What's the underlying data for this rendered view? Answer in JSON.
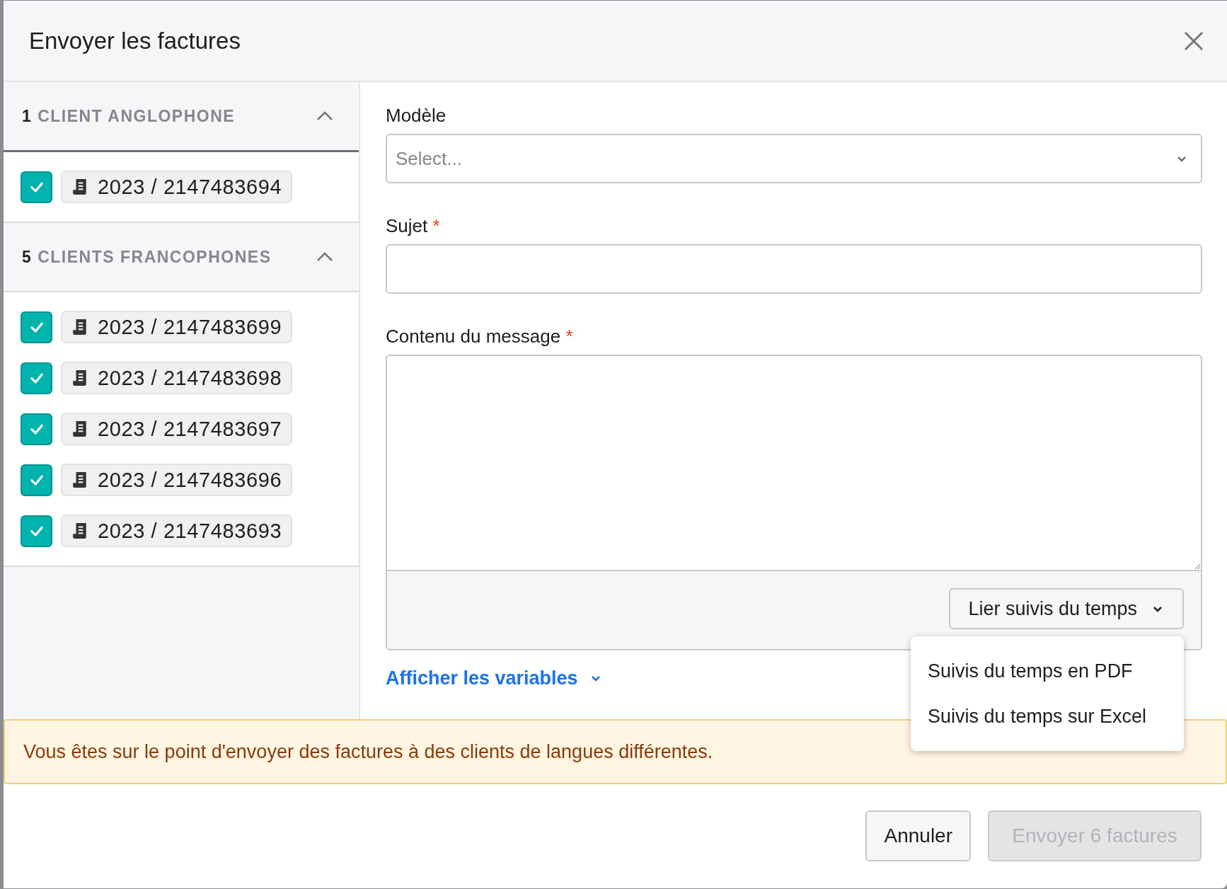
{
  "dialog": {
    "title": "Envoyer les factures"
  },
  "groups": [
    {
      "count": "1",
      "label": "CLIENT ANGLOPHONE",
      "expanded": true,
      "invoices": [
        {
          "number": "2023 / 2147483694",
          "checked": true
        }
      ]
    },
    {
      "count": "5",
      "label": "CLIENTS FRANCOPHONES",
      "expanded": true,
      "invoices": [
        {
          "number": "2023 / 2147483699",
          "checked": true
        },
        {
          "number": "2023 / 2147483698",
          "checked": true
        },
        {
          "number": "2023 / 2147483697",
          "checked": true
        },
        {
          "number": "2023 / 2147483696",
          "checked": true
        },
        {
          "number": "2023 / 2147483693",
          "checked": true
        }
      ]
    }
  ],
  "form": {
    "fields": [
      {
        "kind": "select",
        "label": "Modèle",
        "placeholder": "Select..."
      },
      {
        "kind": "input",
        "label": "Sujet",
        "required_mark": "*"
      },
      {
        "kind": "textarea",
        "label": "Contenu du message",
        "required_mark": "*"
      }
    ],
    "attach_button": {
      "label": "Lier suivis du temps",
      "menu_open": true,
      "menu_items": [
        "Suivis du temps en PDF",
        "Suivis du temps sur Excel"
      ]
    },
    "variables_link": "Afficher les variables"
  },
  "warning": "Vous êtes sur le point d'envoyer des factures à des clients de langues différentes.",
  "buttons": [
    {
      "label": "Annuler",
      "disabled": false
    },
    {
      "label": "Envoyer 6 factures",
      "disabled": true
    }
  ]
}
